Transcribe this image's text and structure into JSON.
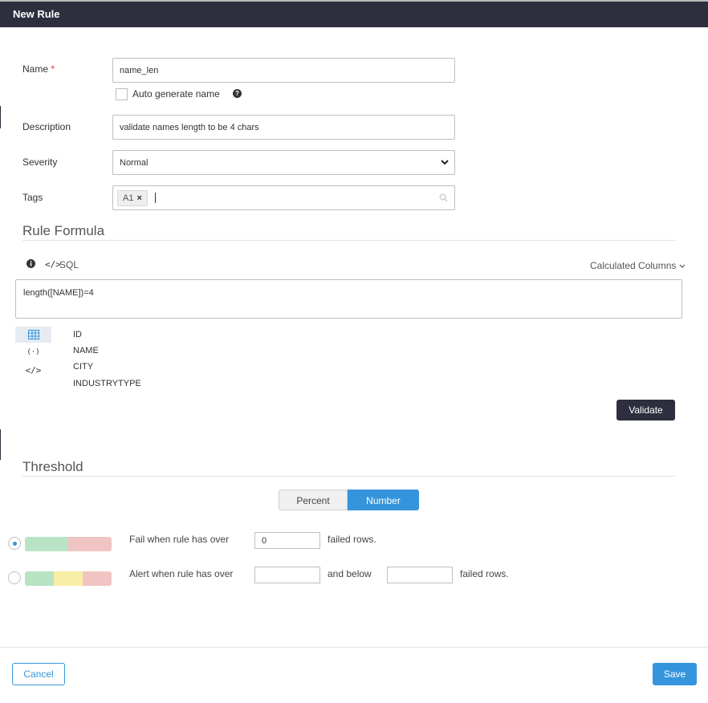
{
  "dialog": {
    "title": "New Rule"
  },
  "form": {
    "name_label": "Name",
    "required_mark": "*",
    "name_value": "name_len",
    "autogen_label": "Auto generate name",
    "description_label": "Description",
    "description_value": "validate names length to be 4 chars",
    "severity_label": "Severity",
    "severity_value": "Normal",
    "tags_label": "Tags",
    "tags": [
      "A1"
    ],
    "tag_remove": "×"
  },
  "formula": {
    "section_title": "Rule Formula",
    "sql_label": "SQL",
    "calculated_columns": "Calculated Columns",
    "expression": "length([NAME])=4",
    "columns": [
      "ID",
      "NAME",
      "CITY",
      "INDUSTRYTYPE"
    ],
    "validate_label": "Validate",
    "icons": [
      "table-icon",
      "function-icon",
      "code-icon"
    ]
  },
  "threshold": {
    "section_title": "Threshold",
    "modes": [
      "Percent",
      "Number"
    ],
    "active_mode": "Number",
    "fail_label": "Fail when rule has over",
    "fail_value": "0",
    "fail_suffix": "failed rows.",
    "alert_label": "Alert when rule has over",
    "alert_mid": "and below",
    "alert_suffix": "failed rows.",
    "selected_option": "fail"
  },
  "footer": {
    "cancel_label": "Cancel",
    "save_label": "Save"
  },
  "colors": {
    "primary": "#3595dc",
    "header": "#2d2e3e",
    "ok": "#b8e4c3",
    "warn": "#f9eea5",
    "fail": "#f0c4c2"
  }
}
